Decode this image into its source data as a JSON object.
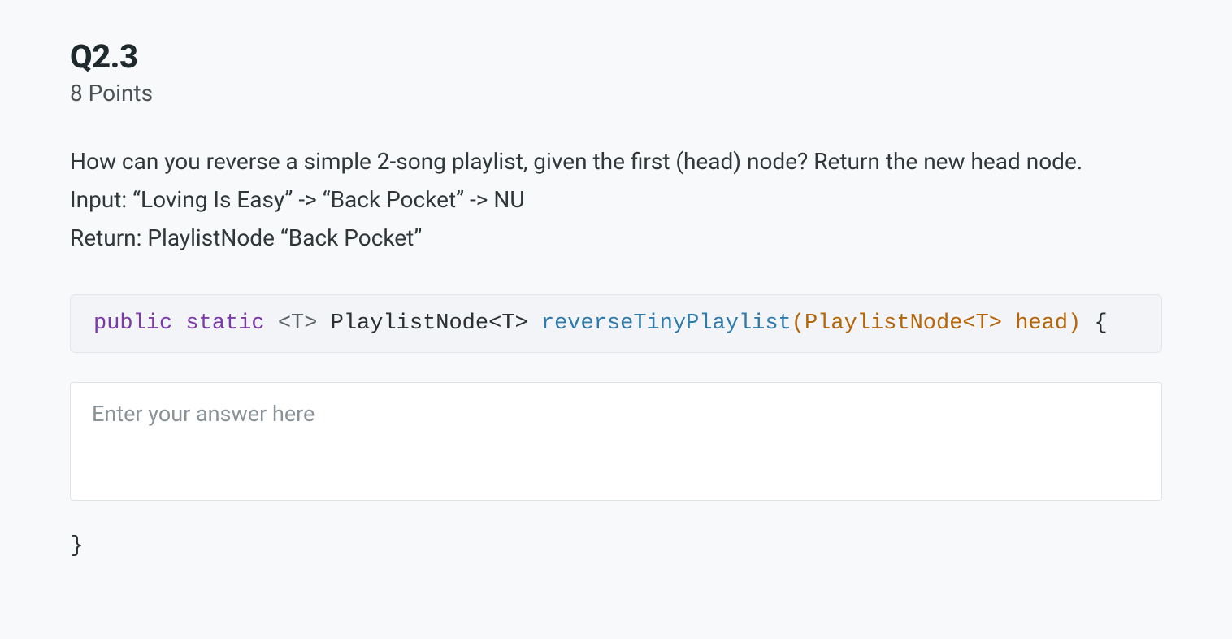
{
  "question": {
    "number": "Q2.3",
    "points": "8 Points",
    "prompt_line1": "How can you reverse a simple 2-song playlist, given the first (head) node? Return the new head node.",
    "prompt_line2": "Input: “Loving Is Easy” -> “Back Pocket” -> NU",
    "prompt_line3": "Return: PlaylistNode “Back Pocket”"
  },
  "code": {
    "kw_public": "public",
    "kw_static": "static",
    "generic": "<T>",
    "return_type": "PlaylistNode<T>",
    "func_name": "reverseTinyPlaylist",
    "paren_open": "(",
    "param_type": "PlaylistNode<T>",
    "param_name": "head",
    "paren_close": ")",
    "brace_open": "{",
    "brace_close": "}"
  },
  "answer": {
    "placeholder": "Enter your answer here",
    "value": ""
  }
}
